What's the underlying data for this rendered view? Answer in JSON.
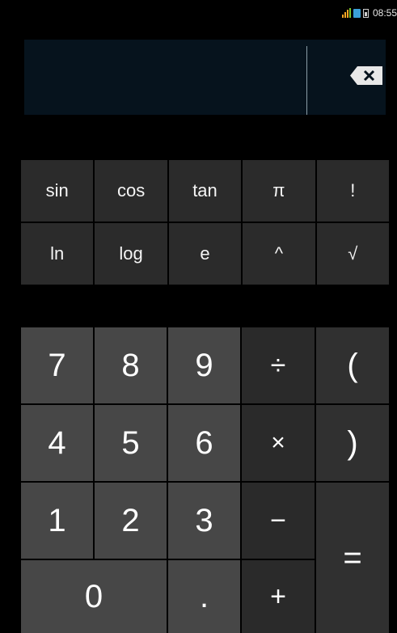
{
  "status_bar": {
    "time": "08:55"
  },
  "display": {
    "expression": ""
  },
  "advanced_keys": [
    "sin",
    "cos",
    "tan",
    "π",
    "!",
    "ln",
    "log",
    "e",
    "^",
    "√"
  ],
  "keys": {
    "seven": "7",
    "eight": "8",
    "nine": "9",
    "divide": "÷",
    "open_paren": "(",
    "four": "4",
    "five": "5",
    "six": "6",
    "multiply": "×",
    "close_paren": ")",
    "one": "1",
    "two": "2",
    "three": "3",
    "minus": "−",
    "equals": "=",
    "zero": "0",
    "dot": ".",
    "plus": "+"
  },
  "colors": {
    "display_bg": "#06131d",
    "digit_bg": "#474747",
    "operator_bg": "#2a2a2a",
    "advanced_bg": "#2b2b2b"
  }
}
